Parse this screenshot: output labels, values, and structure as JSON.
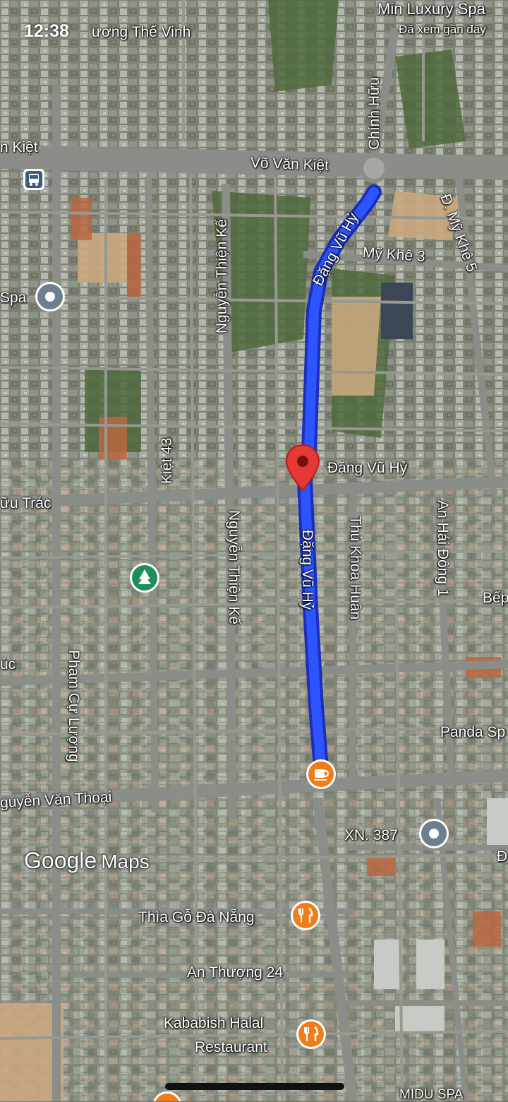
{
  "status_bar": {
    "time": "12:38"
  },
  "attribution": {
    "google": "Google",
    "maps": "Maps"
  },
  "route": {
    "color": "#2148f5",
    "destination_pin_color": "#d32f2f"
  },
  "street_labels": {
    "luong_the_vinh": "ương Thế Vinh",
    "van_kiet_left": "n Kiệt",
    "vo_van_kiet": "Võ Văn Kiệt",
    "chinh_huu": "Chính Hữu",
    "dang_vu_hy_top": "Đặng Vũ Hỷ",
    "my_khe_3": "Mỹ Khê 3",
    "d_my_khe_5": "Đ. Mỹ Khê 5",
    "nguyen_thien_ke_top": "Nguyễn Thiện Kế",
    "kiet_43": "Kiệt 43",
    "huu_trac": "ữu Trác",
    "nguyen_thien_ke_bottom": "Nguyễn Thiện Kế",
    "dang_vu_hy_mid": "Đặng Vũ Hỷ",
    "thu_khoa_huan": "Thủ Khoa Huân",
    "an_hai_dong_1": "An Hải Đông 1",
    "uc": "úc",
    "pham_cu_luong": "Phạm Cự Lượng",
    "nguyen_van_thoai": "guyễn Văn Thoại",
    "an_thuong_24": "An Thượng 24"
  },
  "places": {
    "min_luxury_spa": "Min Luxury Spa",
    "da_xem_gan_day": "Đã xem gần đây",
    "spa_left": "Spa",
    "dang_vu_hy_place": "Đặng Vũ Hỷ",
    "bep": "Bếp",
    "panda_spa": "Panda Sp",
    "xn_387": "XN. 387",
    "right_d": "Đ",
    "thia_go": "Thìa Gỗ Đà Nẵng",
    "kababish_1": "Kababish Halal",
    "kababish_2": "Restaurant",
    "midu_spa": "MIDU SPA"
  },
  "icons": {
    "bus": "bus-stop-icon",
    "spa_pin": "place-pin-icon",
    "park": "park-tree-icon",
    "cafe": "cafe-icon",
    "restaurant": "restaurant-icon",
    "destination": "destination-pin-icon"
  }
}
